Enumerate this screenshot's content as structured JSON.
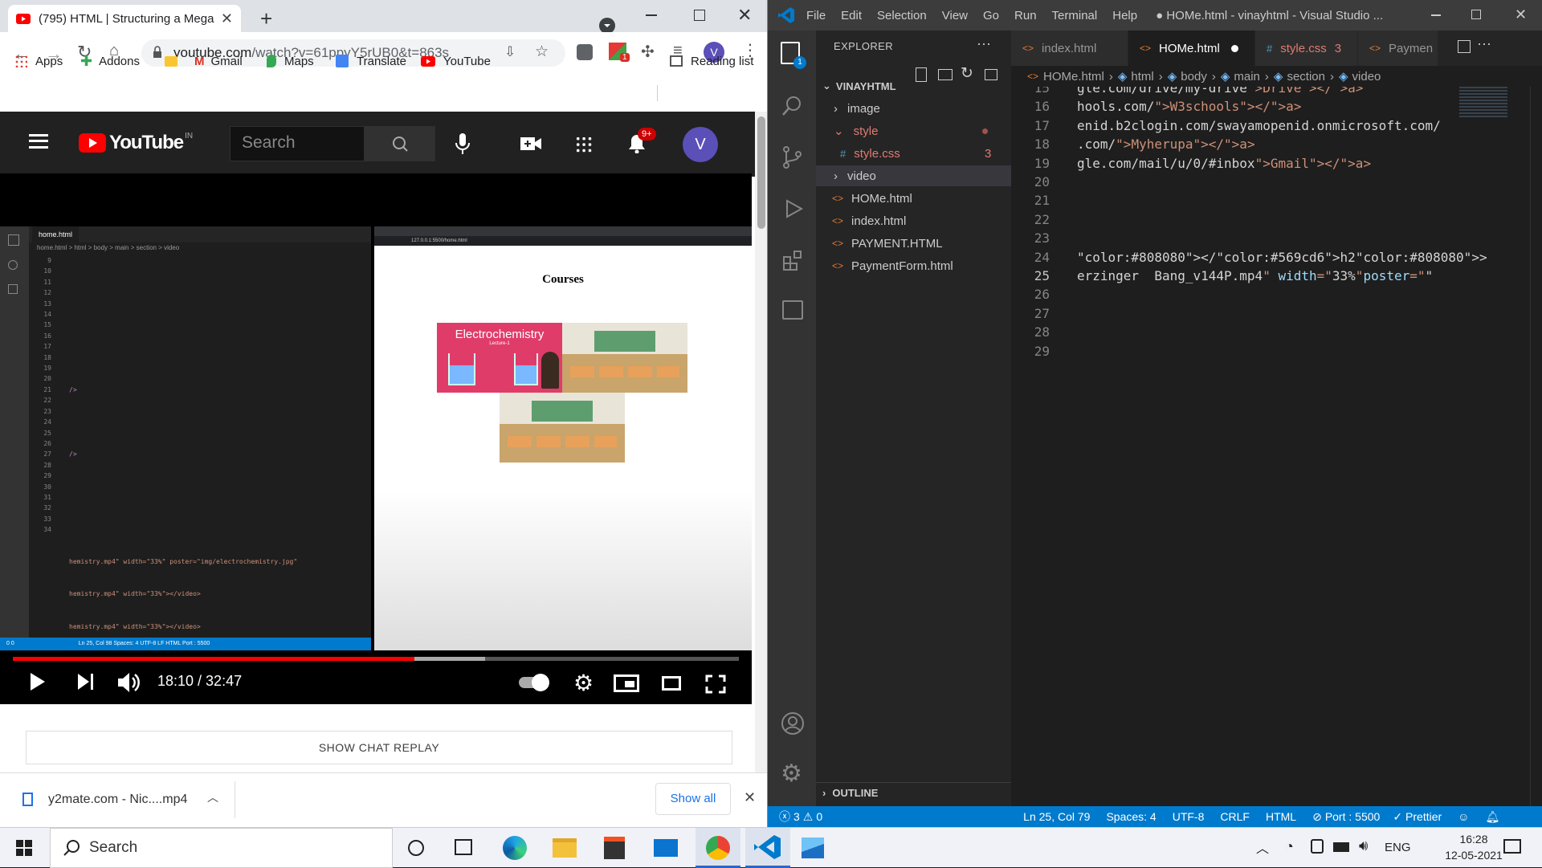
{
  "browser": {
    "tab_title": "(795) HTML | Structuring a Mega",
    "url_domain": "youtube.com",
    "url_path": "/watch?v=61ppyY5rUB0&t=863s",
    "profile_initial": "V",
    "ext_badge": "1",
    "bookmarks": [
      {
        "label": "Apps"
      },
      {
        "label": "Addons"
      },
      {
        "label": ""
      },
      {
        "label": "Gmail"
      },
      {
        "label": "Maps"
      },
      {
        "label": "Translate"
      },
      {
        "label": "YouTube"
      }
    ],
    "reading_list": "Reading list"
  },
  "youtube": {
    "logo_text": "YouTube",
    "region": "IN",
    "search_placeholder": "Search",
    "notif_count": "9+",
    "avatar_initial": "V"
  },
  "video": {
    "inner_vscode": {
      "tab": "home.html",
      "breadcrumb": "home.html > html > body > main > section > video",
      "line_numbers": [
        "9",
        "10",
        "11",
        "12",
        "13",
        "14",
        "15",
        "16",
        "17",
        "18",
        "19",
        "20",
        "21",
        "22",
        "23",
        "24",
        "25",
        "26",
        "27",
        "28",
        "29",
        "30",
        "31",
        "32",
        "33",
        "34"
      ],
      "l17": "/>",
      "l19": "/>",
      "l25": "hemistry.mp4\" width=\"33%\" poster=\"img/electrochemistry.jpg\"",
      "l26": "hemistry.mp4\" width=\"33%\"></video>",
      "l27": "hemistry.mp4\" width=\"33%\"></video>",
      "status": "Ln 25, Col 98   Spaces: 4   UTF-8   LF   HTML   Port : 5500",
      "status_left": "0  0"
    },
    "inner_page": {
      "heading": "Courses",
      "card_title": "Electrochemistry",
      "card_sub": "Lecture-1",
      "address": "127.0.0.1:5500/home.html"
    },
    "progress": 0.553,
    "buffered": 0.65,
    "time": "18:10 / 32:47"
  },
  "chat_replay": "SHOW CHAT REPLAY",
  "download": {
    "file": "y2mate.com - Nic....mp4",
    "show_all": "Show all"
  },
  "vscode": {
    "menu": [
      "File",
      "Edit",
      "Selection",
      "View",
      "Go",
      "Run",
      "Terminal",
      "Help"
    ],
    "title": "● HOMe.html - vinayhtml - Visual Studio ...",
    "activity_badge": "1",
    "explorer_title": "EXPLORER",
    "folder": "VINAYHTML",
    "tree": [
      {
        "name": "image",
        "type": "folder"
      },
      {
        "name": "style",
        "type": "folder-open"
      },
      {
        "name": "style.css",
        "type": "css",
        "badge": "3"
      },
      {
        "name": "video",
        "type": "folder"
      },
      {
        "name": "HOMe.html",
        "type": "html"
      },
      {
        "name": "index.html",
        "type": "html"
      },
      {
        "name": "PAYMENT.HTML",
        "type": "html"
      },
      {
        "name": "PaymentForm.html",
        "type": "html"
      }
    ],
    "outline": "OUTLINE",
    "tabs": [
      {
        "label": "index.html"
      },
      {
        "label": "HOMe.html"
      },
      {
        "label": "style.css",
        "badge": "3"
      },
      {
        "label": "Paymen"
      }
    ],
    "breadcrumb": [
      "HOMe.html",
      "html",
      "body",
      "main",
      "section",
      "video"
    ],
    "lines": [
      {
        "n": "15",
        "t": "gle.com/drive/my-drive\">Drive</a>"
      },
      {
        "n": "16",
        "t": "hools.com/\">W3schools</a>"
      },
      {
        "n": "17",
        "t": "enid.b2clogin.com/swayamopenid.onmicrosoft.com/"
      },
      {
        "n": "18",
        "t": ".com/\">Myherupa</a>"
      },
      {
        "n": "19",
        "t": "gle.com/mail/u/0/#inbox\">Gmail</a>"
      },
      {
        "n": "20",
        "t": ""
      },
      {
        "n": "21",
        "t": ""
      },
      {
        "n": "22",
        "t": ""
      },
      {
        "n": "23",
        "t": ""
      },
      {
        "n": "24",
        "t": "</h2>"
      },
      {
        "n": "25",
        "t": "erzinger  Bang_v144P.mp4\" width=\"33%\"poster=\"\""
      },
      {
        "n": "26",
        "t": ""
      },
      {
        "n": "27",
        "t": ""
      },
      {
        "n": "28",
        "t": ""
      },
      {
        "n": "29",
        "t": ""
      }
    ],
    "status": {
      "problems": "3",
      "warnings": "0",
      "position": "Ln 25, Col 79",
      "spaces": "Spaces: 4",
      "encoding": "UTF-8",
      "eol": "CRLF",
      "language": "HTML",
      "port": "Port : 5500",
      "prettier": "Prettier"
    }
  },
  "taskbar": {
    "search": "Search",
    "lang": "ENG",
    "time": "16:28",
    "date": "12-05-2021"
  }
}
